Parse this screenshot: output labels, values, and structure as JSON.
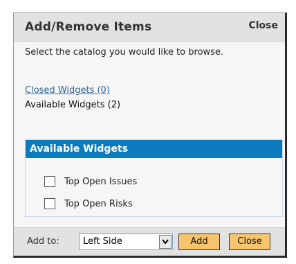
{
  "dialog": {
    "title": "Add/Remove Items",
    "close_label": "Close",
    "instruction": "Select the catalog you would like to browse.",
    "catalogs": {
      "closed_link": "Closed Widgets (0)",
      "available_current": "Available Widgets (2)"
    },
    "panel": {
      "title": "Available Widgets",
      "items": [
        {
          "label": "Top Open Issues",
          "checked": false
        },
        {
          "label": "Top Open Risks",
          "checked": false
        }
      ]
    },
    "footer": {
      "add_to_label": "Add to:",
      "location_selected": "Left Side",
      "add_button": "Add",
      "close_button": "Close"
    }
  },
  "colors": {
    "panel_header_bg": "#0c7bbd",
    "button_bg": "#f6c46c",
    "link": "#336699"
  },
  "icons": {
    "select_arrow": "chevron-down-icon"
  }
}
